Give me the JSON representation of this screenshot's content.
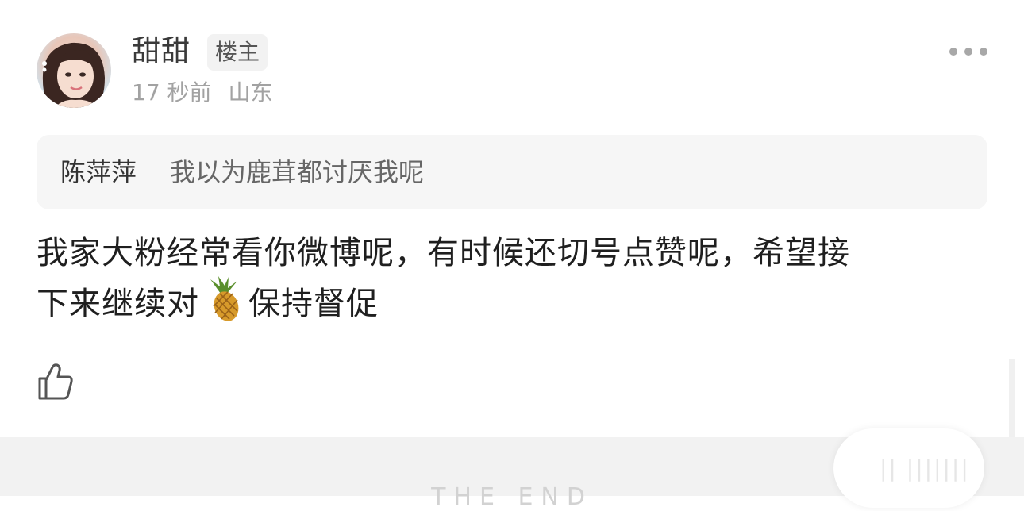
{
  "post": {
    "author": {
      "name": "甜甜",
      "badge": "楼主"
    },
    "meta": {
      "time": "17 秒前",
      "location": "山东"
    },
    "more_icon": "ellipsis-icon"
  },
  "quote": {
    "author": "陈萍萍",
    "text": "我以为鹿茸都讨厌我呢"
  },
  "content": {
    "line1": "我家大粉经常看你微博呢，有时候还切号点赞呢，希望接",
    "line2_before": "下来继续对",
    "emoji": "pineapple-icon",
    "line2_after": "保持督促"
  },
  "actions": {
    "like_icon": "thumbs-up-icon"
  },
  "footer": {
    "the_end": "THE END"
  },
  "colors": {
    "quote_bg": "#f6f6f6",
    "footer_bg": "#f2f2f2",
    "secondary_text": "#a2a2a2"
  }
}
